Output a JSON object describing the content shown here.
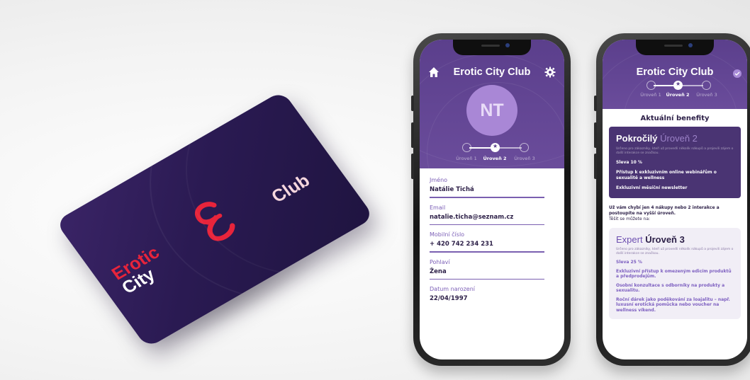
{
  "card": {
    "logo_top": "Erotic",
    "logo_bottom": "City",
    "club_label": "Club",
    "emblem": "ec-monogram-icon"
  },
  "phone_profile": {
    "title": "Erotic City Club",
    "home_icon": "home-icon",
    "settings_icon": "gear-icon",
    "avatar_initials": "NT",
    "levels": [
      {
        "label": "Úroveň 1",
        "active": false
      },
      {
        "label": "Úroveň 2",
        "active": true
      },
      {
        "label": "Úroveň 3",
        "active": false
      }
    ],
    "fields": [
      {
        "label": "Jméno",
        "value": "Natálie Tichá"
      },
      {
        "label": "Email",
        "value": "natalie.ticha@seznam.cz"
      },
      {
        "label": "Mobilní číslo",
        "value": "+ 420 742 234 231"
      },
      {
        "label": "Pohlaví",
        "value": "Žena"
      },
      {
        "label": "Datum narození",
        "value": "22/04/1997"
      }
    ]
  },
  "phone_benefits": {
    "title": "Erotic City Club",
    "levels": [
      {
        "label": "Úroveň 1",
        "active": false
      },
      {
        "label": "Úroveň 2",
        "active": true
      },
      {
        "label": "Úroveň 3",
        "active": false
      }
    ],
    "benefits_heading": "Aktuální benefity",
    "current_tier": {
      "name": "Pokročilý",
      "level": "Úroveň 2",
      "description": "Určeno pro zákazníky, kteří už provedli několik nákupů a projevili zájem o další interakce se značkou.",
      "items": [
        "Sleva 10 %",
        "Přístup k exkluzivním online webinářům o sexualitě a wellness",
        "Exkluzivní měsíční newsletter"
      ]
    },
    "missing_text": "Už vám chybí jen 4 nákupy nebo 2 interakce a postoupíte na vyšší úroveň.",
    "missing_sub": "Těšit se můžete na:",
    "next_tier": {
      "name": "Expert",
      "level": "Úroveň 3",
      "description": "Určeno pro zákazníky, kteří už provedli několik nákupů a projevili zájem o další interakce se značkou.",
      "items": [
        "Sleva 25 %",
        "Exkluzivní přístup k omezeným edicím produktů a předprodejům.",
        "Osobní konzultace s odborníky na produkty a sexualitu.",
        "Roční dárek jako poděkování za loajalitu – např. luxusní erotická pomůcka nebo voucher na wellness víkend."
      ]
    }
  },
  "colors": {
    "primary_purple": "#5b3f8c",
    "dark_purple": "#2c1f47",
    "accent_red": "#e8243b",
    "card_bg": "#2a1a52"
  }
}
